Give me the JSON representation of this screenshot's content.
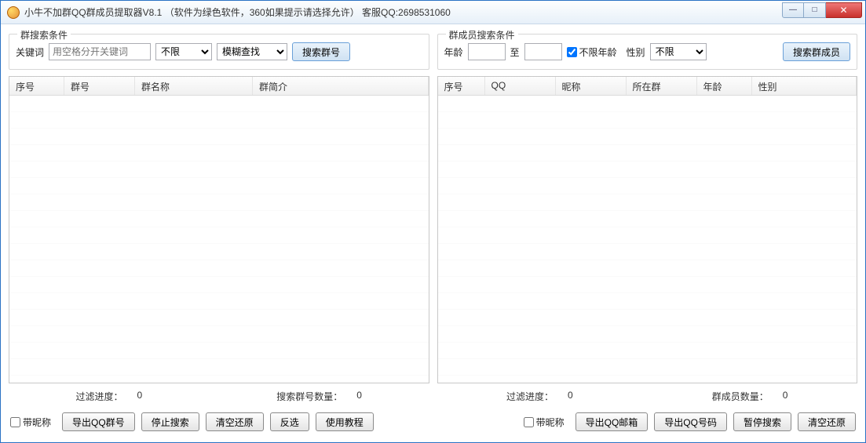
{
  "window": {
    "title": "小牛不加群QQ群成员提取器V8.1     （软件为绿色软件，360如果提示请选择允许）  客服QQ:2698531060"
  },
  "left": {
    "groupTitle": "群搜索条件",
    "keywordLabel": "关键词",
    "keywordPlaceholder": "用空格分开关键词",
    "limitSelect": "不限",
    "matchSelect": "模糊查找",
    "searchBtn": "搜索群号",
    "columns": [
      "序号",
      "群号",
      "群名称",
      "群简介"
    ],
    "status": {
      "filterLabel": "过滤进度：",
      "filterValue": "0",
      "countLabel": "搜索群号数量：",
      "countValue": "0"
    },
    "bottom": {
      "nickCheck": "带昵称",
      "exportBtn": "导出QQ群号",
      "stopBtn": "停止搜索",
      "clearBtn": "清空还原",
      "invertBtn": "反选",
      "tutorialBtn": "使用教程"
    }
  },
  "right": {
    "groupTitle": "群成员搜索条件",
    "ageLabel": "年龄",
    "toLabel": "至",
    "unlimitedAge": "不限年龄",
    "genderLabel": "性别",
    "genderSelect": "不限",
    "searchBtn": "搜索群成员",
    "columns": [
      "序号",
      "QQ",
      "昵称",
      "所在群",
      "年龄",
      "性别"
    ],
    "status": {
      "filterLabel": "过滤进度：",
      "filterValue": "0",
      "countLabel": "群成员数量：",
      "countValue": "0"
    },
    "bottom": {
      "nickCheck": "带昵称",
      "exportMailBtn": "导出QQ邮箱",
      "exportNumBtn": "导出QQ号码",
      "pauseBtn": "暂停搜索",
      "clearBtn": "清空还原"
    }
  }
}
